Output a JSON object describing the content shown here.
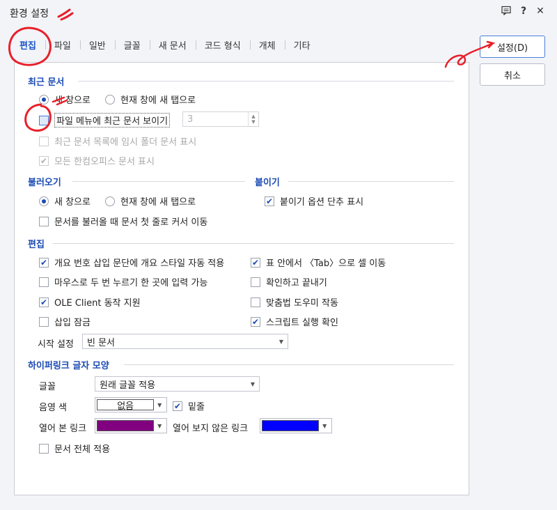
{
  "window": {
    "title": "환경 설정",
    "icons": [
      "comment-icon",
      "help-icon",
      "close-icon"
    ],
    "help_glyph": "?",
    "close_glyph": "✕"
  },
  "tabs": [
    "편집",
    "파일",
    "일반",
    "글꼴",
    "새 문서",
    "코드 형식",
    "개체",
    "기타"
  ],
  "active_tab": "편집",
  "buttons": {
    "ok": "설정(D)",
    "cancel": "취소"
  },
  "recent": {
    "title": "최근 문서",
    "radio_new": "새 창으로",
    "radio_tab": "현재 창에 새 탭으로",
    "show_in_menu": "파일 메뉴에 최근 문서 보이기",
    "count": "3",
    "temp_folder": "최근 문서 목록에 임시 폴더 문서 표시",
    "all_hancom": "모든 한컴오피스 문서 표시"
  },
  "open": {
    "title": "불러오기",
    "radio_new": "새 창으로",
    "radio_tab": "현재 창에 새 탭으로",
    "cursor_first": "문서를 불러올 때 문서 첫 줄로 커서 이동"
  },
  "paste": {
    "title": "붙이기",
    "shortcut": "붙이기 옵션 단추 표시"
  },
  "edit": {
    "title": "편집",
    "outline_style": "개요 번호 삽입 문단에 개요 스타일 자동 적용",
    "tab_cell": "표 안에서 〈Tab〉으로 셀 이동",
    "dblclick": "마우스로 두 번 누르기 한 곳에 입력 가능",
    "confirm_exit": "확인하고 끝내기",
    "ole": "OLE Client 동작 지원",
    "spell": "맞춤법 도우미 작동",
    "insert_lock": "삽입 잠금",
    "script_confirm": "스크립트 실행 확인",
    "start_label": "시작 설정",
    "start_value": "빈 문서"
  },
  "hyperlink": {
    "title": "하이퍼링크 글자 모양",
    "font_label": "글꼴",
    "font_value": "원래 글꼴 적용",
    "shade_label": "음영 색",
    "shade_value": "없음",
    "underline": "밑줄",
    "visited_label": "열어 본 링크",
    "visited_color": "#800080",
    "unvisited_label": "열어 보지 않은 링크",
    "unvisited_color": "#0000ff",
    "apply_all": "문서 전체 적용"
  },
  "colors": {
    "accent": "#1b4bb4",
    "annotation": "#e8202a"
  }
}
